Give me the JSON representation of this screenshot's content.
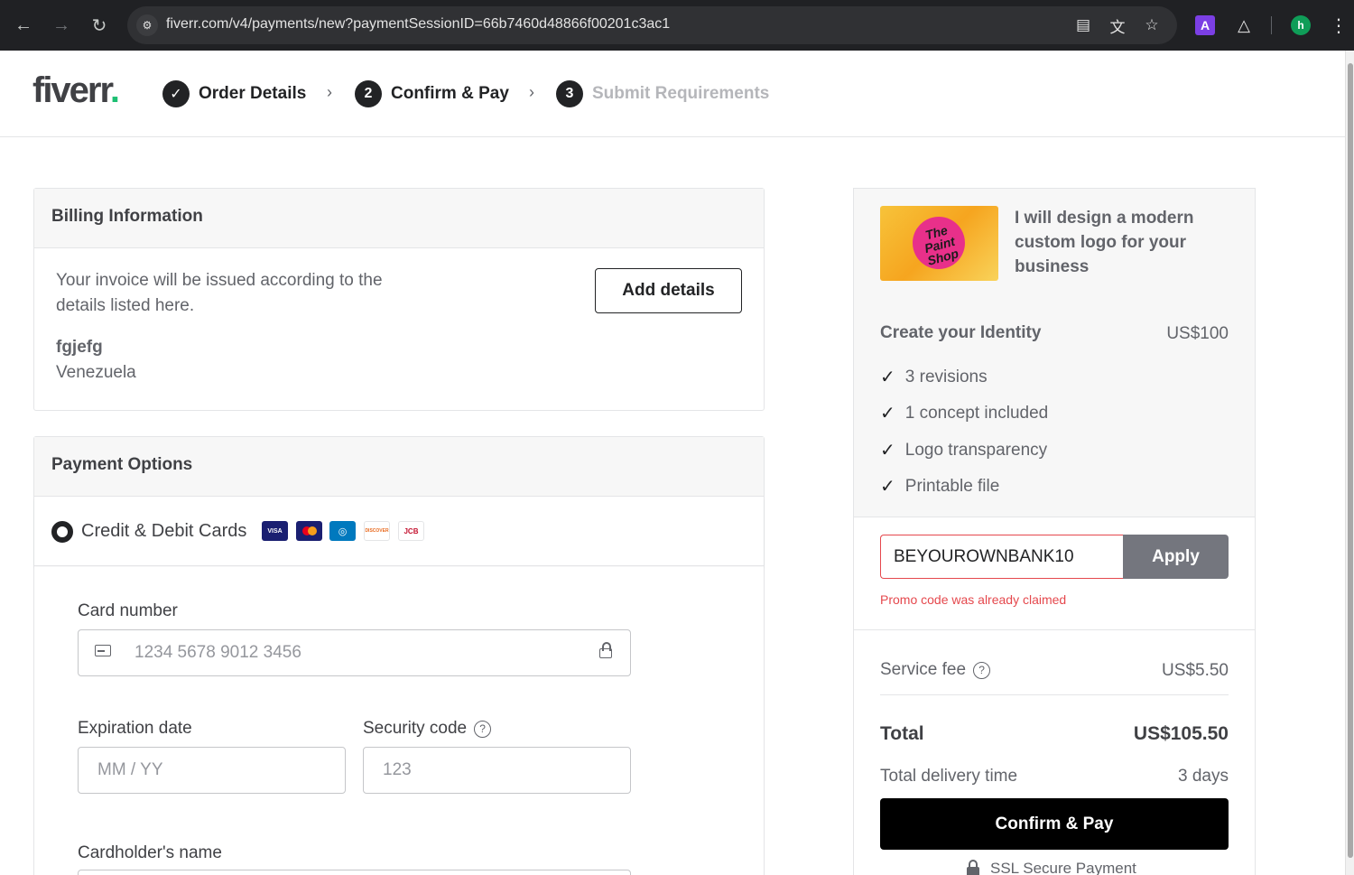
{
  "browser": {
    "url": "fiverr.com/v4/payments/new?paymentSessionID=66b7460d48866f00201c3ac1",
    "profile_initial": "h",
    "extension_label": "A"
  },
  "header": {
    "logo": "fiverr",
    "logo_dot": ".",
    "steps": [
      {
        "number": "✓",
        "label": "Order Details"
      },
      {
        "number": "2",
        "label": "Confirm & Pay"
      },
      {
        "number": "3",
        "label": "Submit Requirements"
      }
    ]
  },
  "billing": {
    "title": "Billing Information",
    "description": "Your invoice will be issued according to the details listed here.",
    "add_button": "Add details",
    "name": "fgjefg",
    "country": "Venezuela"
  },
  "payment": {
    "title": "Payment Options",
    "method_label": "Credit & Debit Cards",
    "card_brands": [
      "VISA",
      "MC",
      "DC",
      "DISCOVER",
      "JCB"
    ],
    "card_number_label": "Card number",
    "card_number_placeholder": "1234 5678 9012 3456",
    "expiration_label": "Expiration date",
    "expiration_placeholder": "MM / YY",
    "security_label": "Security code",
    "security_placeholder": "123",
    "cardholder_label": "Cardholder's name"
  },
  "summary": {
    "gig_title": "I will design a modern custom logo for your business",
    "thumb_text": "The Paint Shop",
    "package_name": "Create your Identity",
    "package_price": "US$100",
    "features": [
      "3 revisions",
      "1 concept included",
      "Logo transparency",
      "Printable file"
    ],
    "promo_code": "BEYOUROWNBANK10",
    "apply_label": "Apply",
    "promo_error": "Promo code was already claimed",
    "service_fee_label": "Service fee",
    "service_fee_value": "US$5.50",
    "total_label": "Total",
    "total_value": "US$105.50",
    "delivery_label": "Total delivery time",
    "delivery_value": "3 days",
    "confirm_label": "Confirm & Pay",
    "ssl_label": "SSL Secure Payment"
  },
  "colors": {
    "brand_green": "#1dbf73",
    "error_red": "#e5484d",
    "apply_gray": "#74767e"
  }
}
